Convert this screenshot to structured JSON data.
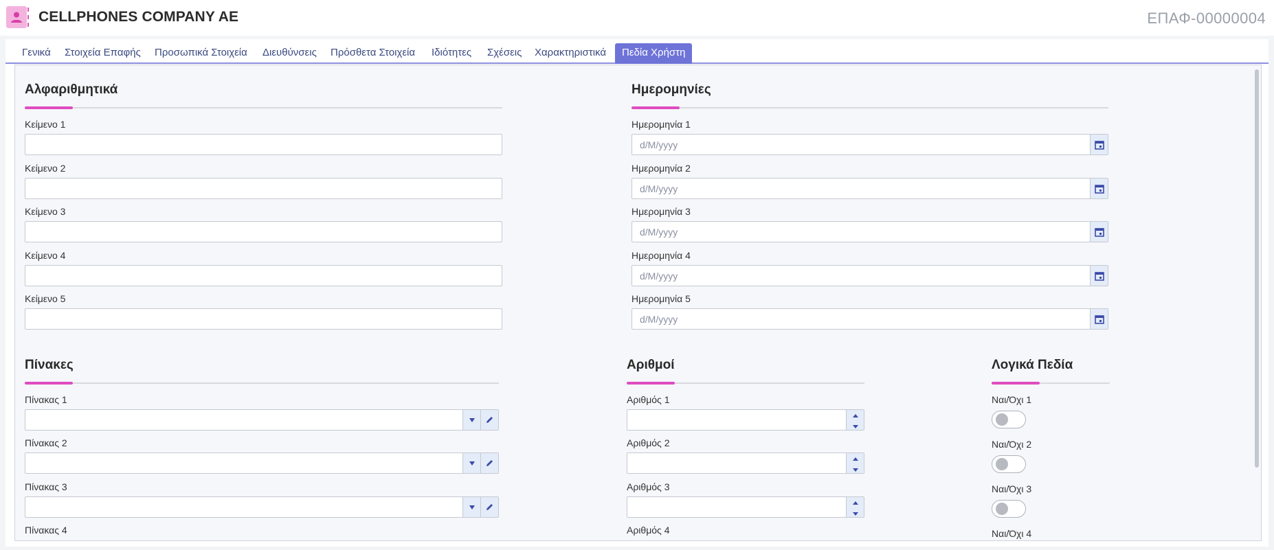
{
  "header": {
    "title": "CELLPHONES COMPANY AE",
    "code": "ΕΠΑΦ-00000004",
    "avatar_icon": "user-icon"
  },
  "tabs": [
    {
      "label": "Γενικά"
    },
    {
      "label": "Στοιχεία Επαφής"
    },
    {
      "label": "Προσωπικά Στοιχεία"
    },
    {
      "label": "Διευθύνσεις"
    },
    {
      "label": "Πρόσθετα Στοιχεία"
    },
    {
      "label": "Ιδιότητες"
    },
    {
      "label": "Σχέσεις"
    },
    {
      "label": "Χαρακτηριστικά"
    },
    {
      "label": "Πεδία Χρήστη",
      "active": true
    }
  ],
  "sections": {
    "alpha": {
      "title": "Αλφαριθμητικά",
      "fields": [
        {
          "label": "Κείμενο 1",
          "value": ""
        },
        {
          "label": "Κείμενο 2",
          "value": ""
        },
        {
          "label": "Κείμενο 3",
          "value": ""
        },
        {
          "label": "Κείμενο 4",
          "value": ""
        },
        {
          "label": "Κείμενο 5",
          "value": ""
        }
      ]
    },
    "dates": {
      "title": "Ημερομηνίες",
      "placeholder": "d/M/yyyy",
      "fields": [
        {
          "label": "Ημερομηνία 1"
        },
        {
          "label": "Ημερομηνία 2"
        },
        {
          "label": "Ημερομηνία 3"
        },
        {
          "label": "Ημερομηνία 4"
        },
        {
          "label": "Ημερομηνία 5"
        }
      ]
    },
    "tables": {
      "title": "Πίνακες",
      "fields": [
        {
          "label": "Πίνακας 1"
        },
        {
          "label": "Πίνακας 2"
        },
        {
          "label": "Πίνακας 3"
        },
        {
          "label": "Πίνακας 4"
        }
      ]
    },
    "numbers": {
      "title": "Αριθμοί",
      "fields": [
        {
          "label": "Αριθμός 1"
        },
        {
          "label": "Αριθμός 2"
        },
        {
          "label": "Αριθμός 3"
        },
        {
          "label": "Αριθμός 4"
        }
      ]
    },
    "booleans": {
      "title": "Λογικά Πεδία",
      "fields": [
        {
          "label": "Ναι/Όχι 1",
          "checked": false
        },
        {
          "label": "Ναι/Όχι 2",
          "checked": false
        },
        {
          "label": "Ναι/Όχι 3",
          "checked": false
        },
        {
          "label": "Ναι/Όχι 4",
          "checked": false
        }
      ]
    }
  },
  "colors": {
    "accent": "#6e73d8",
    "section_accent": "#e04cc0",
    "avatar_bg": "#f4b3df"
  }
}
